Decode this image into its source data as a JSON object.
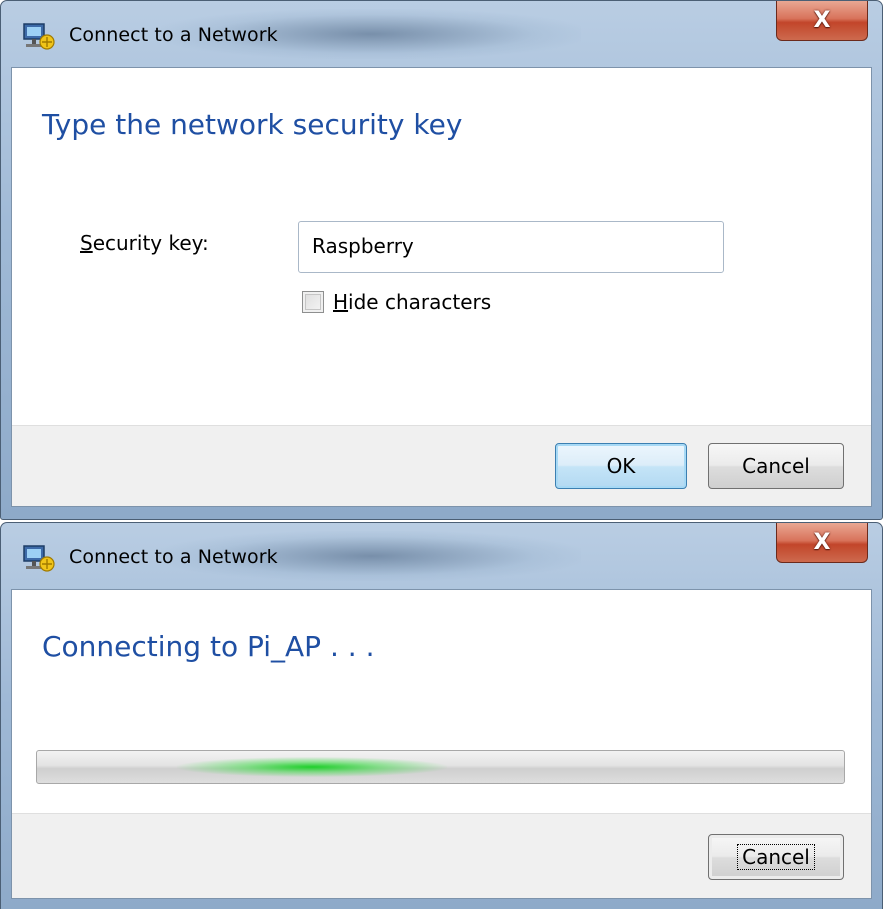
{
  "dialog1": {
    "title": "Connect to a Network",
    "close_label": "X",
    "heading": "Type the network security key",
    "security_key_label_access": "S",
    "security_key_label_rest": "ecurity key:",
    "security_key_value": "Raspberry",
    "hide_characters_access": "H",
    "hide_characters_rest": "ide characters",
    "hide_characters_checked": false,
    "ok_label": "OK",
    "cancel_label": "Cancel"
  },
  "dialog2": {
    "title": "Connect to a Network",
    "close_label": "X",
    "heading": "Connecting to Pi_AP . . .",
    "progress_state": "indeterminate",
    "cancel_label": "Cancel"
  },
  "icons": [
    "network-icon",
    "close-icon",
    "checkbox-icon"
  ],
  "colors": {
    "heading_blue": "#1f4fa3",
    "close_red": "#c2452a",
    "progress_green": "#1fcf2b",
    "footer_gray": "#f0f0f0"
  }
}
